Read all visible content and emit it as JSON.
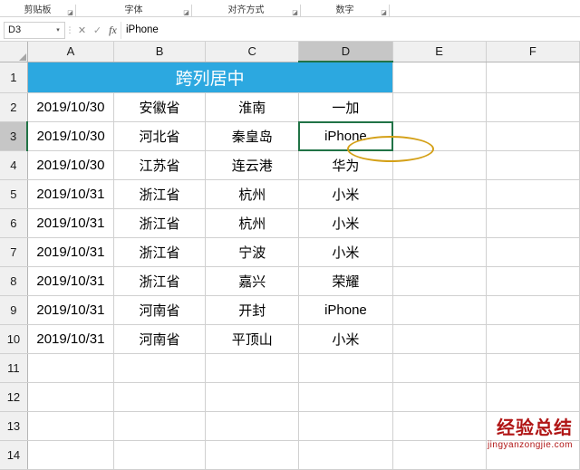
{
  "ribbon": {
    "groups": [
      {
        "label": "剪贴板",
        "dialog_icon": "◪"
      },
      {
        "label": "字体",
        "dialog_icon": "◪"
      },
      {
        "label": "对齐方式",
        "dialog_icon": "◪"
      },
      {
        "label": "数字",
        "dialog_icon": "◪"
      }
    ]
  },
  "formula_bar": {
    "name_box_value": "D3",
    "name_box_arrow": "▾",
    "gripper": "⋮",
    "cancel_icon": "✕",
    "confirm_icon": "✓",
    "function_icon": "fx",
    "content": "iPhone"
  },
  "sheet": {
    "columns": [
      "A",
      "B",
      "C",
      "D",
      "E",
      "F"
    ],
    "selected_column": "D",
    "rows": [
      "1",
      "2",
      "3",
      "4",
      "5",
      "6",
      "7",
      "8",
      "9",
      "10",
      "11",
      "12",
      "13",
      "14"
    ],
    "selected_row": "3",
    "banner": {
      "text": "跨列居中",
      "span_columns": [
        "A",
        "B",
        "C",
        "D"
      ],
      "bg_color": "#2ca8e0",
      "text_color": "#ffffff"
    },
    "active_cell": "D3",
    "data": [
      [
        "2019/10/30",
        "安徽省",
        "淮南",
        "一加",
        "",
        ""
      ],
      [
        "2019/10/30",
        "河北省",
        "秦皇岛",
        "iPhone",
        "",
        ""
      ],
      [
        "2019/10/30",
        "江苏省",
        "连云港",
        "华为",
        "",
        ""
      ],
      [
        "2019/10/31",
        "浙江省",
        "杭州",
        "小米",
        "",
        ""
      ],
      [
        "2019/10/31",
        "浙江省",
        "杭州",
        "小米",
        "",
        ""
      ],
      [
        "2019/10/31",
        "浙江省",
        "宁波",
        "小米",
        "",
        ""
      ],
      [
        "2019/10/31",
        "浙江省",
        "嘉兴",
        "荣耀",
        "",
        ""
      ],
      [
        "2019/10/31",
        "河南省",
        "开封",
        "iPhone",
        "",
        ""
      ],
      [
        "2019/10/31",
        "河南省",
        "平顶山",
        "小米",
        "",
        ""
      ],
      [
        "",
        "",
        "",
        "",
        "",
        ""
      ],
      [
        "",
        "",
        "",
        "",
        "",
        ""
      ],
      [
        "",
        "",
        "",
        "",
        "",
        ""
      ],
      [
        "",
        "",
        "",
        "",
        "",
        ""
      ]
    ]
  },
  "annotation": {
    "highlight_shape": "ellipse",
    "highlight_color": "#d4a017",
    "highlight_target": "D3"
  },
  "watermark": {
    "title": "经验总结",
    "subtitle": "jingyanzongjie.com",
    "color": "#b01515"
  }
}
